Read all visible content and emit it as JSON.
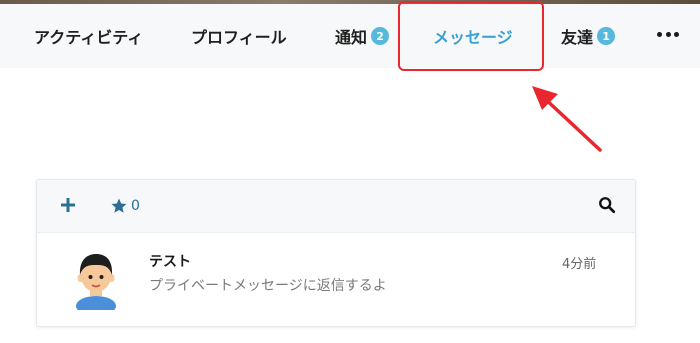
{
  "nav": {
    "items": [
      {
        "label": "アクティビティ"
      },
      {
        "label": "プロフィール"
      },
      {
        "label": "通知",
        "badge": "2"
      },
      {
        "label": "メッセージ"
      },
      {
        "label": "友達",
        "badge": "1"
      }
    ],
    "active_color": "#3aa0cf",
    "badge_color": "#55b8dc"
  },
  "annotation": {
    "highlight_color": "#e8282e"
  },
  "messages_panel": {
    "toolbar": {
      "starred_count": "0"
    },
    "messages": [
      {
        "sender": "テスト",
        "preview": "プライベートメッセージに返信するよ",
        "time": "4分前"
      }
    ]
  }
}
